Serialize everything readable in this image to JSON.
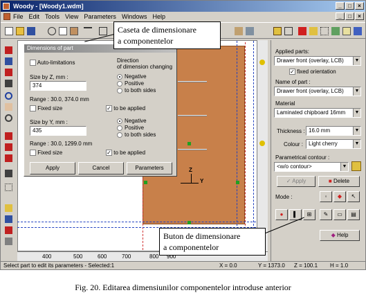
{
  "window": {
    "title": "Woody - [Woody1.wdm]"
  },
  "menu": [
    "File",
    "Edit",
    "Tools",
    "View",
    "Parameters",
    "Windows",
    "Help"
  ],
  "callouts": {
    "top": [
      "Caseta de dimensionare",
      "a componentelor"
    ],
    "bottom": [
      "Buton de dimensionare",
      "a componentelor"
    ]
  },
  "dialog": {
    "title": "Dimensions of part",
    "auto_limitations": "Auto-limitations",
    "direction_label": [
      "Direction",
      "of dimension changing"
    ],
    "size_z_label": "Size by Z, mm :",
    "size_z_value": "374",
    "range_z": "Range :  30.0, 374.0 mm",
    "size_y_label": "Size by Y, mm :",
    "size_y_value": "435",
    "range_y": "Range :  30.0, 1299.0 mm",
    "fixed_size": "Fixed size",
    "to_be_applied": "to be applied",
    "options": [
      "Negative",
      "Positive",
      "to both sides"
    ],
    "buttons": {
      "apply": "Apply",
      "cancel": "Cancel",
      "parameters": "Parameters"
    }
  },
  "panel": {
    "applied_parts_label": "Applied parts:",
    "applied_parts_value": "Drawer front (overlay, LCB)",
    "fixed_orientation": "fixed orientation",
    "name_label": "Name of part :",
    "name_value": "Drawer front (overlay, LCB)",
    "material_label": "Material",
    "material_value": "Laminated chipboard 16mm",
    "thickness_label": "Thickness :",
    "thickness_value": "16.0 mm",
    "colour_label": "Colour :",
    "colour_value": "Light cherry",
    "contour_label": "Parametrical contour :",
    "contour_value": "<w/o contour>",
    "apply": "Apply",
    "delete": "Delete",
    "mode_label": "Mode :",
    "help": "Help"
  },
  "ruler": [
    "400",
    "500",
    "600",
    "700",
    "800",
    "900"
  ],
  "axes": {
    "z": "Z",
    "y": "Y"
  },
  "status": {
    "hint": "Select part to edit its parameters - Selected:1",
    "x": "X = 0.0",
    "y": "Y = 1373.0",
    "z": "Z = 100.1",
    "h": "H = 1.0"
  },
  "caption": "Fig. 20. Editarea dimensiunilor componentelor introduse anterior",
  "colors": {
    "part": "#c8804a",
    "title_active": "#0a246a",
    "panel": "#d4d0c8"
  }
}
